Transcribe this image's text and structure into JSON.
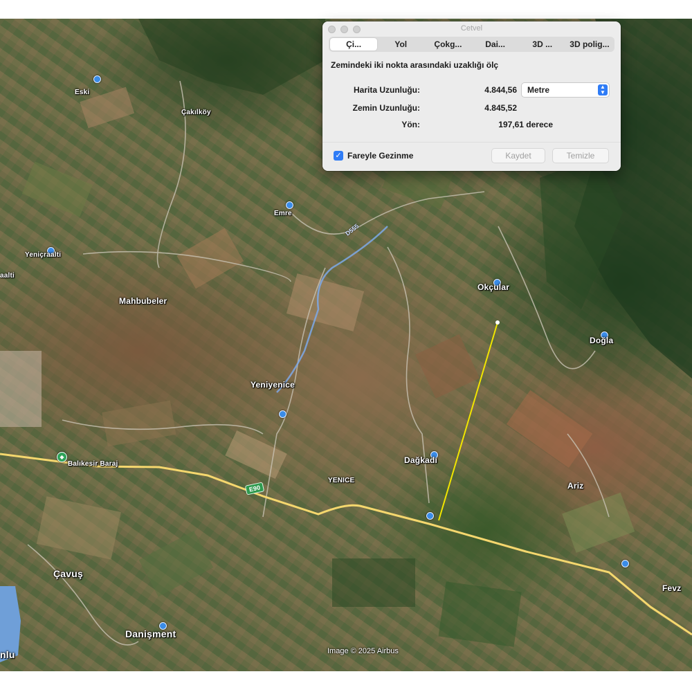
{
  "window": {
    "title": "Cetvel",
    "tabs": [
      {
        "label": "Çi...",
        "active": true
      },
      {
        "label": "Yol",
        "active": false
      },
      {
        "label": "Çokg...",
        "active": false
      },
      {
        "label": "Dai...",
        "active": false
      },
      {
        "label": "3D ...",
        "active": false
      },
      {
        "label": "3D polig...",
        "active": false
      }
    ],
    "description": "Zemindeki iki nokta arasındaki uzaklığı ölç",
    "map_length_label": "Harita Uzunluğu:",
    "map_length_value": "4.844,56",
    "ground_length_label": "Zemin Uzunluğu:",
    "ground_length_value": "4.845,52",
    "heading_label": "Yön:",
    "heading_value": "197,61 derece",
    "unit": "Metre",
    "mouse_nav_label": "Fareyle Gezinme",
    "mouse_nav_checked": true,
    "save_label": "Kaydet",
    "clear_label": "Temizle"
  },
  "map": {
    "places": {
      "eski": "Eski",
      "cakilkoy": "Çakılköy",
      "emre": "Emre",
      "yenicraalti": "Yeniçraalti",
      "aalti": "aalti",
      "mahbubeler": "Mahbubeler",
      "okcular": "Okçular",
      "dogla": "Doğla",
      "yeniyenice": "Yeniyenice",
      "dagkadi": "Dağkadı",
      "yenice": "YENICE",
      "ariz": "Ariz",
      "cavus": "Çavuş",
      "danisment": "Danişment",
      "nlu": "nlu",
      "fevz": "Fevz",
      "baraj": "Balıkesir Baraj"
    },
    "road_badge": "E90",
    "road_label": "D555",
    "credit": "Image © 2025 Airbus",
    "colors": {
      "measure_line": "#f2e600",
      "highway": "#f5d76e",
      "poi": "#3a8ce8",
      "accent": "#2f7cf6"
    }
  }
}
